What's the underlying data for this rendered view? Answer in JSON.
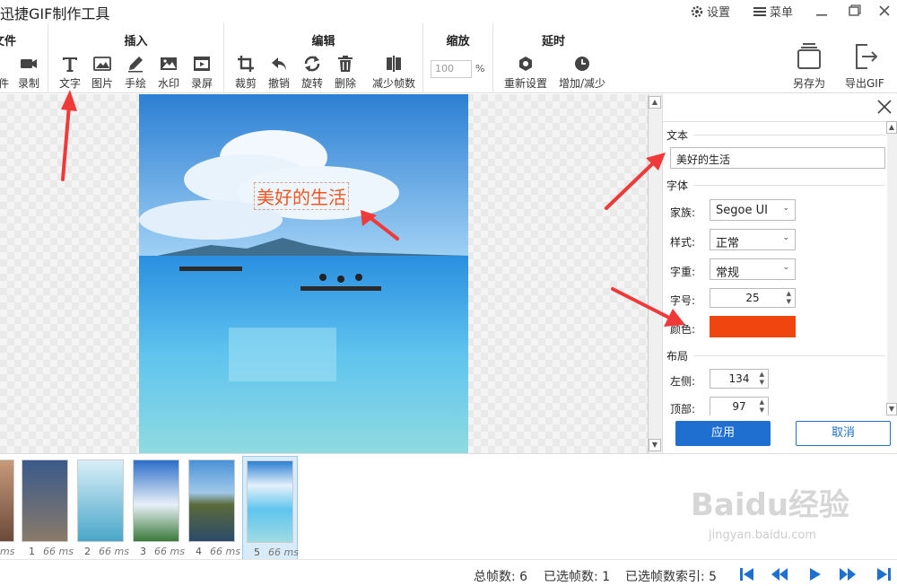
{
  "app": {
    "title": "迅捷GIF制作工具"
  },
  "titlebar": {
    "settings_label": "设置",
    "menu_label": "菜单"
  },
  "ribbon": {
    "groups": [
      {
        "title": "文件",
        "tools": [
          "件",
          "录制"
        ]
      },
      {
        "title": "插入",
        "tools": [
          "文字",
          "图片",
          "手绘",
          "水印",
          "录屏"
        ]
      },
      {
        "title": "编辑",
        "tools": [
          "裁剪",
          "撤销",
          "旋转",
          "删除",
          "减少帧数"
        ]
      },
      {
        "title": "缩放",
        "zoom_value": "100",
        "zoom_unit": "%"
      },
      {
        "title": "延时",
        "tools": [
          "重新设置",
          "增加/减少"
        ]
      }
    ],
    "save_as": "另存为",
    "export_gif": "导出GIF"
  },
  "canvas": {
    "overlay_text": "美好的生活"
  },
  "panel": {
    "text_section": "文本",
    "text_value": "美好的生活",
    "font_section": "字体",
    "family_label": "家族:",
    "family_value": "Segoe UI",
    "style_label": "样式:",
    "style_value": "正常",
    "weight_label": "字重:",
    "weight_value": "常规",
    "size_label": "字号:",
    "size_value": "25",
    "color_label": "颜色:",
    "color_value": "#f0450f",
    "layout_section": "布局",
    "left_label": "左侧:",
    "left_value": "134",
    "top_label": "顶部:",
    "top_value": "97",
    "apply": "应用",
    "cancel": "取消"
  },
  "frames": [
    {
      "index": "",
      "ms": "ms"
    },
    {
      "index": "1",
      "ms": "66 ms"
    },
    {
      "index": "2",
      "ms": "66 ms"
    },
    {
      "index": "3",
      "ms": "66 ms"
    },
    {
      "index": "4",
      "ms": "66 ms"
    },
    {
      "index": "5",
      "ms": "66 ms"
    }
  ],
  "status": {
    "total": "总帧数: 6",
    "selected": "已选帧数: 1",
    "selected_index": "已选帧数索引: 5"
  },
  "watermark": {
    "brand": "Baidu经验",
    "url": "jingyan.baidu.com"
  },
  "colors": {
    "accent": "#1e6fd0",
    "text_color": "#f05522",
    "annotation": "#f03a3a"
  }
}
